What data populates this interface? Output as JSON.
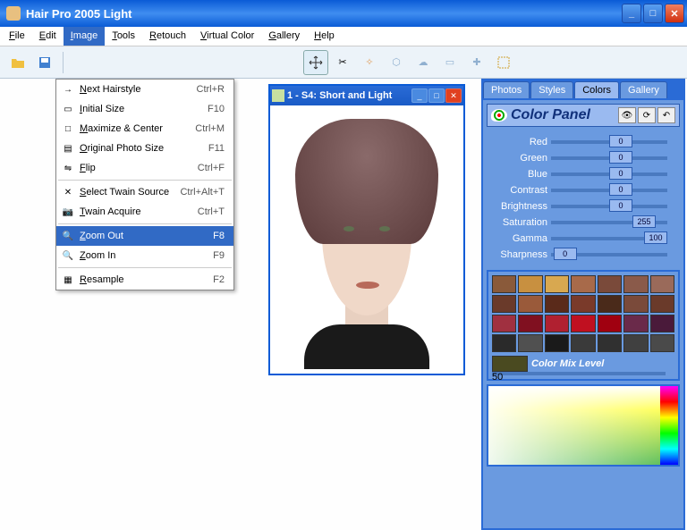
{
  "window": {
    "title": "Hair Pro 2005  Light"
  },
  "menubar": [
    "File",
    "Edit",
    "Image",
    "Tools",
    "Retouch",
    "Virtual Color",
    "Gallery",
    "Help"
  ],
  "active_menu_index": 2,
  "dropdown": [
    {
      "label": "Next Hairstyle",
      "shortcut": "Ctrl+R",
      "icon": "→"
    },
    {
      "label": "Initial Size",
      "shortcut": "F10",
      "icon": "▭"
    },
    {
      "label": "Maximize & Center",
      "shortcut": "Ctrl+M",
      "icon": "□"
    },
    {
      "label": "Original Photo Size",
      "shortcut": "F11",
      "icon": "▤"
    },
    {
      "label": "Flip",
      "shortcut": "Ctrl+F",
      "icon": "⇋"
    },
    {
      "sep": true
    },
    {
      "label": "Select Twain Source",
      "shortcut": "Ctrl+Alt+T",
      "icon": "✕"
    },
    {
      "label": "Twain Acquire",
      "shortcut": "Ctrl+T",
      "icon": "📷"
    },
    {
      "sep": true
    },
    {
      "label": "Zoom Out",
      "shortcut": "F8",
      "icon": "🔍",
      "hover": true
    },
    {
      "label": "Zoom In",
      "shortcut": "F9",
      "icon": "🔍"
    },
    {
      "sep": true
    },
    {
      "label": "Resample",
      "shortcut": "F2",
      "icon": "▦"
    }
  ],
  "photo_window": {
    "title": "1 - S4: Short and Light"
  },
  "tabs": [
    "Photos",
    "Styles",
    "Colors",
    "Gallery"
  ],
  "active_tab_index": 2,
  "color_panel": {
    "title": "Color Panel",
    "sliders": [
      {
        "name": "Red",
        "value": 0,
        "pos": 50
      },
      {
        "name": "Green",
        "value": 0,
        "pos": 50
      },
      {
        "name": "Blue",
        "value": 0,
        "pos": 50
      },
      {
        "name": "Contrast",
        "value": 0,
        "pos": 50
      },
      {
        "name": "Brightness",
        "value": 0,
        "pos": 50
      },
      {
        "name": "Saturation",
        "value": 255,
        "pos": 70
      },
      {
        "name": "Gamma",
        "value": 100,
        "pos": 80
      },
      {
        "name": "Sharpness",
        "value": 0,
        "pos": 2
      }
    ],
    "swatches": [
      "#8a5a3a",
      "#c89040",
      "#d8a850",
      "#a86a4a",
      "#7a4a3a",
      "#8a5a4a",
      "#9a6a5a",
      "#6a3a2a",
      "#9a5a3a",
      "#5a2a1a",
      "#7a3a2a",
      "#4a2a1a",
      "#7a4a3a",
      "#6a3a2a",
      "#a03040",
      "#801020",
      "#b02030",
      "#c01020",
      "#a00010",
      "#6a2a4a",
      "#4a1a3a",
      "#2a2a2a",
      "#505050",
      "#1a1a1a",
      "#3a3a3a",
      "#303030",
      "#404040",
      "#4a4a4a"
    ],
    "mix_label": "Color Mix Level",
    "mix_value": 50
  }
}
